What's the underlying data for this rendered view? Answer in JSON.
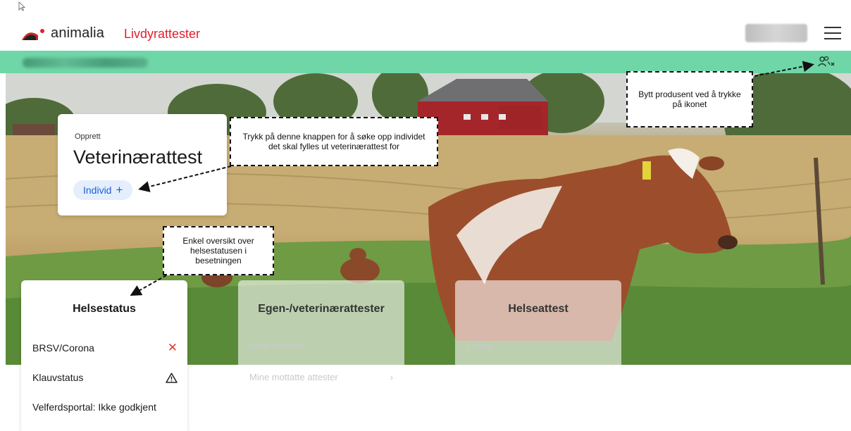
{
  "header": {
    "brand": "animalia",
    "app_name": "Livdyrattester",
    "icons": [
      "pointer-cursor-icon",
      "animalia-logo",
      "hamburger-menu-icon"
    ]
  },
  "producer_bar": {
    "switch_icon": "switch-producer-icon"
  },
  "create_card": {
    "eyebrow": "Opprett",
    "title": "Veterinærattest",
    "button_label": "Individ",
    "button_icon": "+"
  },
  "health_card": {
    "title": "Helsestatus",
    "rows": [
      {
        "label": "BRSV/Corona",
        "icon": "✕",
        "icon_name": "close-icon",
        "color": "#e53935"
      },
      {
        "label": "Klauvstatus",
        "icon": "⚠",
        "icon_name": "warning-icon",
        "color": "#222222"
      },
      {
        "label": "Velferdsportal: Ikke godkjent",
        "icon": "",
        "icon_name": "",
        "color": "#222222"
      }
    ]
  },
  "certificates_card": {
    "title": "Egen-/veterinærattester",
    "links": [
      {
        "label": "Mine attester",
        "chevron": "›"
      },
      {
        "label": "Mine mottatte attester",
        "chevron": "›"
      }
    ]
  },
  "health_certificate_card": {
    "title": "Helseattest",
    "links": [
      {
        "label": "Individ",
        "chevron": "›"
      }
    ]
  },
  "annotations": {
    "switch_producer": "Bytt produsent ved å trykke på ikonet",
    "individ_button": "Trykk på denne knappen for å søke opp individet det skal fylles ut veterinærattest for",
    "health_overview": "Enkel oversikt over helsestatusen i besetningen"
  },
  "colors": {
    "brand_red": "#e2202c",
    "producer_bar": "#6fd6a8",
    "primary_blue": "#1a5fd6",
    "chip_bg": "#e4eefc"
  }
}
